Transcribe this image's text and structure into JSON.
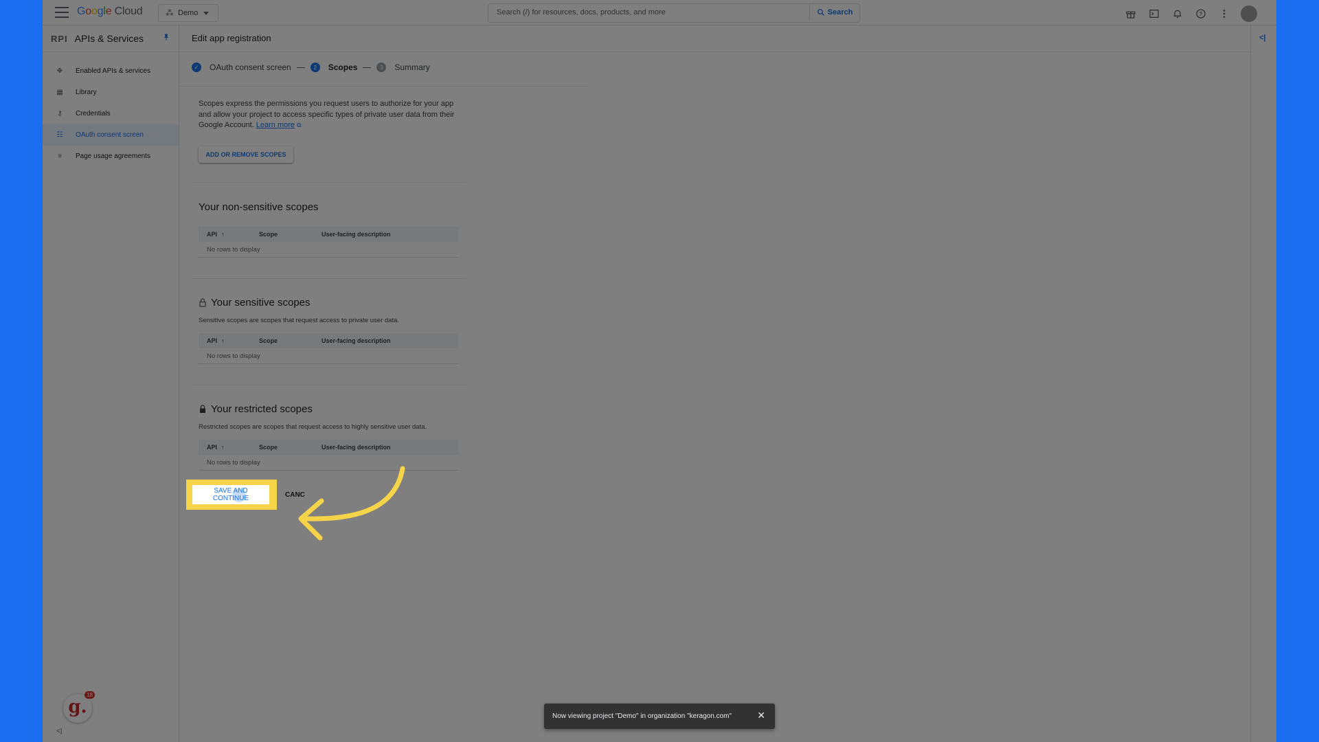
{
  "topbar": {
    "logo": {
      "g": "G",
      "o1": "o",
      "o2": "o",
      "g2": "g",
      "l": "l",
      "e": "e",
      "cloud": " Cloud"
    },
    "project": "Demo",
    "search_placeholder": "Search (/) for resources, docs, products, and more",
    "search_label": "Search"
  },
  "sidebar": {
    "api_mark": "RPI",
    "title": "APIs & Services",
    "items": [
      {
        "label": "Enabled APIs & services",
        "icon": "api-icon"
      },
      {
        "label": "Library",
        "icon": "library-icon"
      },
      {
        "label": "Credentials",
        "icon": "key-icon"
      },
      {
        "label": "OAuth consent screen",
        "icon": "consent-icon"
      },
      {
        "label": "Page usage agreements",
        "icon": "agreements-icon"
      }
    ],
    "extension_badge_count": "18",
    "extension_letter": "g."
  },
  "main": {
    "title": "Edit app registration",
    "steps": [
      {
        "label": "OAuth consent screen",
        "state": "done"
      },
      {
        "label": "Scopes",
        "state": "current",
        "num": "2"
      },
      {
        "label": "Summary",
        "state": "future",
        "num": "3"
      }
    ],
    "intro_text": "Scopes express the permissions you request users to authorize for your app and allow your project to access specific types of private user data from their Google Account. ",
    "learn_more": "Learn more",
    "add_scopes_label": "ADD OR REMOVE SCOPES",
    "table_headers": {
      "api": "API",
      "scope": "Scope",
      "desc": "User-facing description"
    },
    "empty_text": "No rows to display",
    "sections": {
      "non_sensitive": {
        "title": "Your non-sensitive scopes"
      },
      "sensitive": {
        "title": "Your sensitive scopes",
        "desc": "Sensitive scopes are scopes that request access to private user data."
      },
      "restricted": {
        "title": "Your restricted scopes",
        "desc": "Restricted scopes are scopes that request access to highly sensitive user data."
      }
    },
    "save_label": "SAVE AND CONTINUE",
    "cancel_label": "CANC"
  },
  "toast": {
    "message": "Now viewing project \"Demo\" in organization \"keragon.com\""
  },
  "colors": {
    "accent": "#1a73e8",
    "highlight": "#f6d44a",
    "background": "#1a6cf0"
  }
}
